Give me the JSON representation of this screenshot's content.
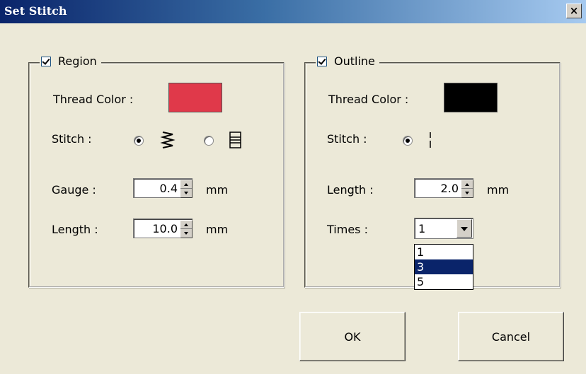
{
  "window": {
    "title": "Set Stitch",
    "close_glyph": "×"
  },
  "region": {
    "legend": "Region",
    "checked": true,
    "thread_color_label": "Thread Color :",
    "thread_color": "#e0394a",
    "stitch_label": "Stitch :",
    "stitch_options": [
      {
        "icon": "zigzag-fill-icon",
        "selected": true
      },
      {
        "icon": "parallel-lines-icon",
        "selected": false
      }
    ],
    "gauge_label": "Gauge :",
    "gauge_value": "0.4",
    "gauge_unit": "mm",
    "length_label": "Length :",
    "length_value": "10.0",
    "length_unit": "mm"
  },
  "outline": {
    "legend": "Outline",
    "checked": true,
    "thread_color_label": "Thread Color :",
    "thread_color": "#000000",
    "stitch_label": "Stitch :",
    "stitch_options": [
      {
        "icon": "running-stitch-icon",
        "selected": true
      }
    ],
    "length_label": "Length :",
    "length_value": "2.0",
    "length_unit": "mm",
    "times_label": "Times :",
    "times_value": "1",
    "times_options": [
      "1",
      "3",
      "5"
    ],
    "times_highlighted": "3"
  },
  "buttons": {
    "ok": "OK",
    "cancel": "Cancel"
  }
}
